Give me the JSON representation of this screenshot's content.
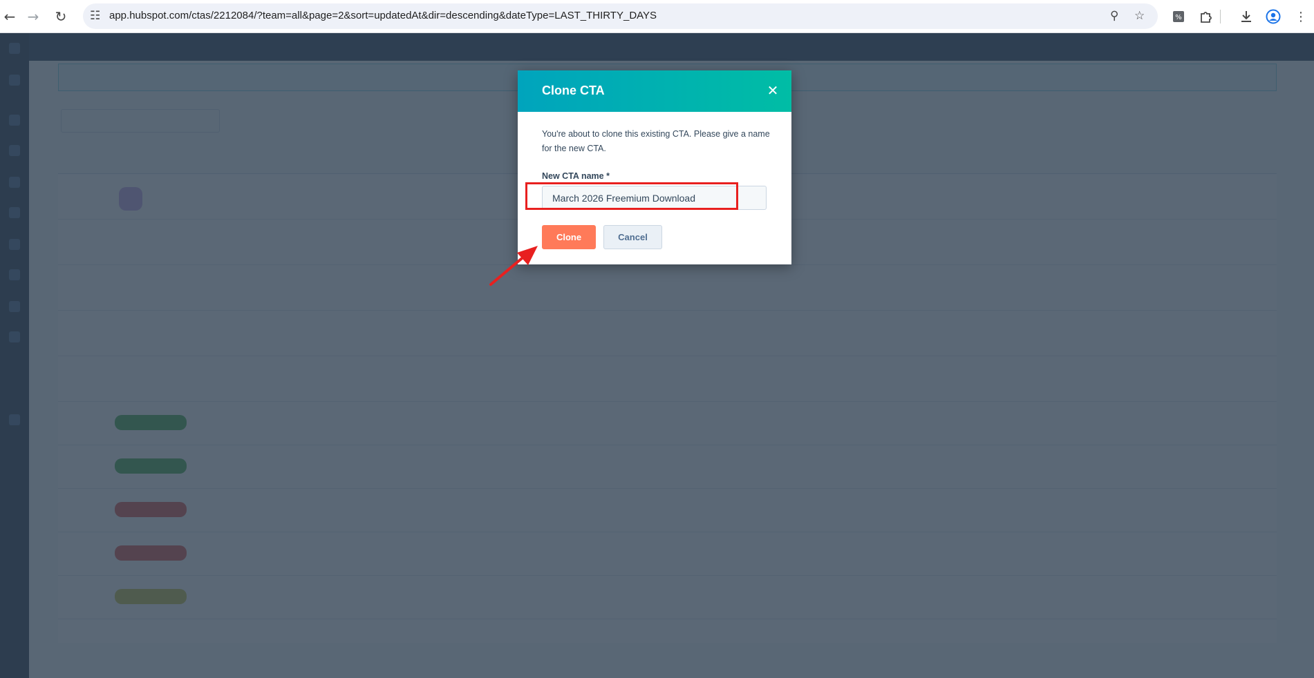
{
  "browser": {
    "url": "app.hubspot.com/ctas/2212084/?team=all&page=2&sort=updatedAt&dir=descending&dateType=LAST_THIRTY_DAYS",
    "icons": [
      "back-icon",
      "forward-icon",
      "reload-icon",
      "site-info-icon",
      "zoom-icon",
      "bookmark-star-icon",
      "extension-icon",
      "puzzle-icon",
      "download-icon",
      "profile-icon",
      "menu-icon"
    ]
  },
  "modal": {
    "title": "Clone CTA",
    "description": "You're about to clone this existing CTA. Please give a name for the new CTA.",
    "field_label": "New CTA name *",
    "field_value": "March 2026 Freemium Download",
    "clone_label": "Clone",
    "cancel_label": "Cancel"
  },
  "colors": {
    "header_gradient_start": "#00a4bd",
    "header_gradient_end": "#00bda5",
    "primary_button": "#ff7a59",
    "annotation_red": "#e8201f"
  }
}
